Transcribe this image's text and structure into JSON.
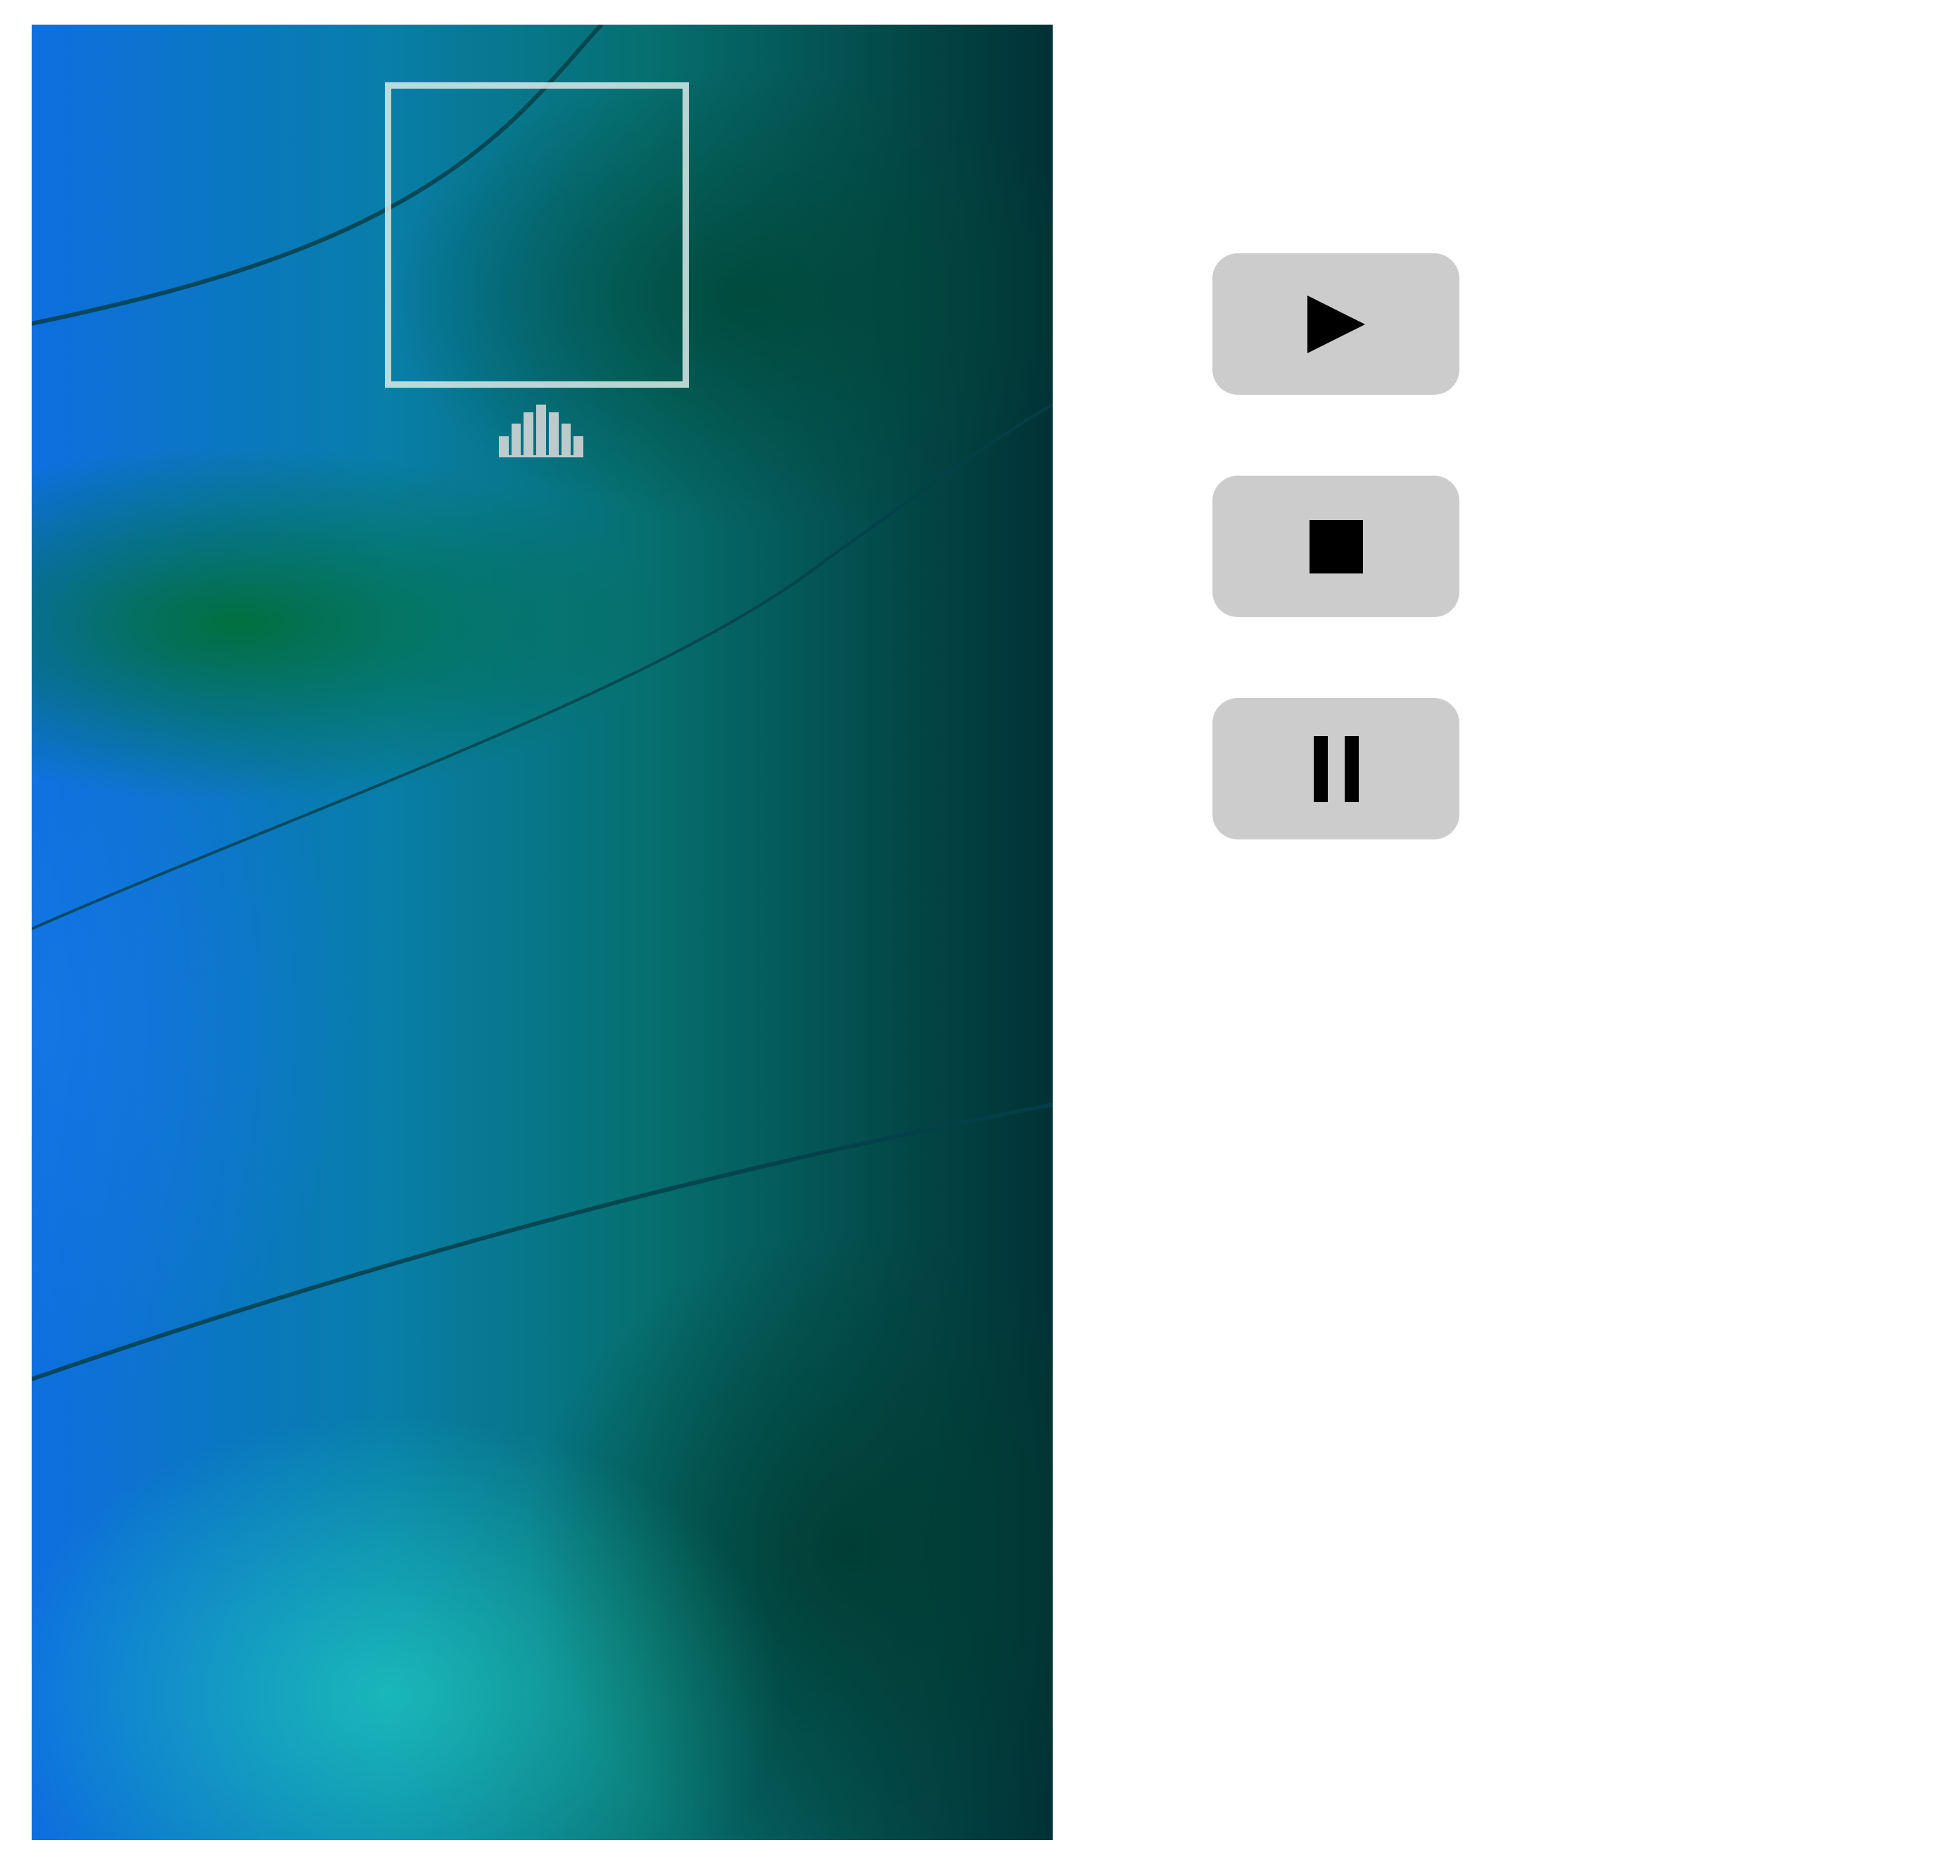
{
  "player": {
    "visualizer_levels": [
      0.38,
      0.62,
      0.85,
      1.0,
      0.85,
      0.62,
      0.38
    ]
  },
  "controls": [
    {
      "name": "play",
      "icon": "play-icon"
    },
    {
      "name": "stop",
      "icon": "stop-icon"
    },
    {
      "name": "pause",
      "icon": "pause-icon"
    }
  ],
  "colors": {
    "button_background": "#cccccc",
    "icon_color": "#000000",
    "frame_color": "#d7ebe8"
  }
}
